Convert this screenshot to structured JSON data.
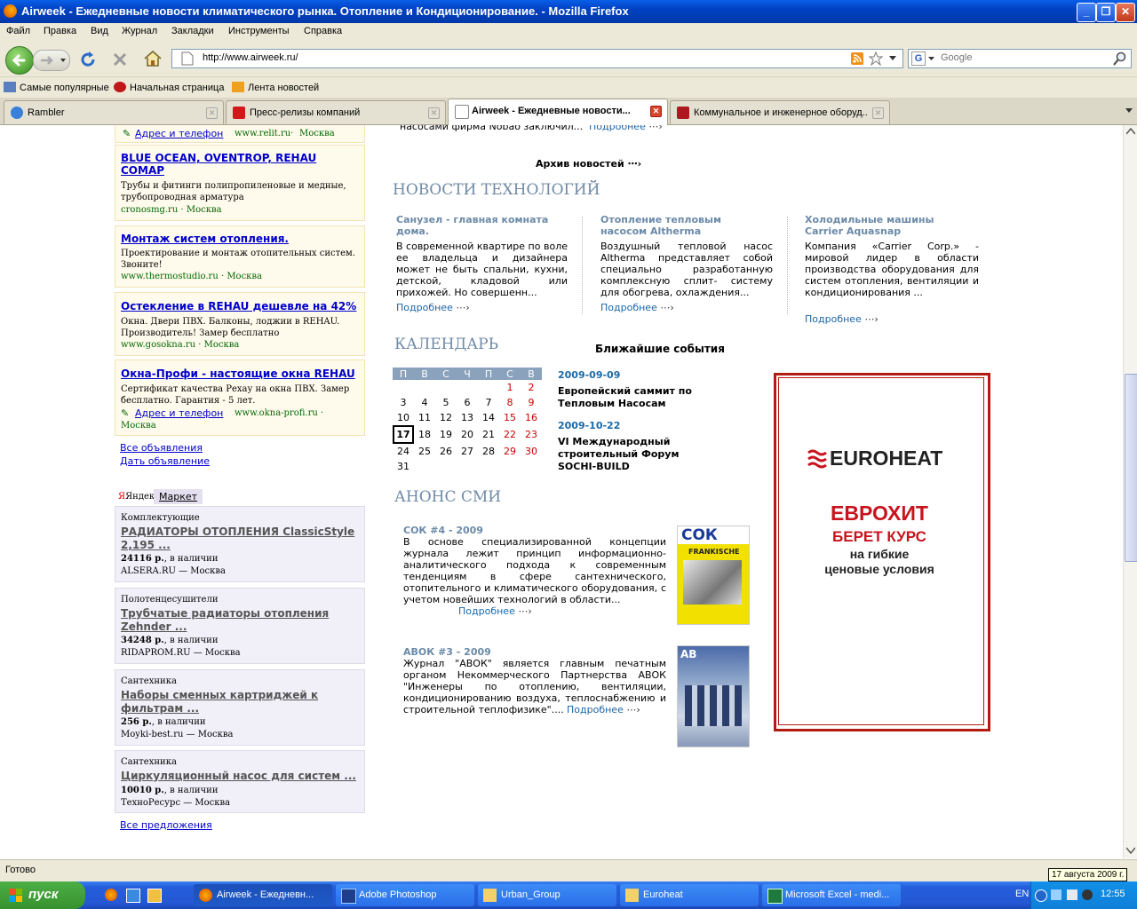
{
  "window": {
    "title": "Airweek - Ежедневные новости климатического рынка. Отопление и Кондиционирование. - Mozilla Firefox",
    "min": "_",
    "max": "❐",
    "close": "✕"
  },
  "menu": [
    "Файл",
    "Правка",
    "Вид",
    "Журнал",
    "Закладки",
    "Инструменты",
    "Справка"
  ],
  "nav": {
    "url": "http://www.airweek.ru/",
    "search_placeholder": "Google",
    "search_engine": "G"
  },
  "bookmarks": [
    "Самые популярные",
    "Начальная страница",
    "Лента новостей"
  ],
  "tabs": [
    {
      "label": "Rambler",
      "active": false
    },
    {
      "label": "Пресс-релизы компаний",
      "active": false
    },
    {
      "label": "Airweek - Ежедневные новости...",
      "active": true
    },
    {
      "label": "Коммунальное и инженерное оборуд...",
      "active": false
    }
  ],
  "ads": {
    "top_addr": "Адрес и телефон",
    "top_site": "www.relit.ru",
    "top_city": "Москва",
    "items": [
      {
        "title": "BLUE OCEAN, OVENTROP, REHAU COMAP",
        "desc": "Трубы и фитинги полипропиленовые и медные, трубопроводная арматура",
        "site": "cronosmg.ru",
        "city": "Москва"
      },
      {
        "title": "Монтаж систем отопления.",
        "desc": "Проектирование и монтаж отопительных систем. Звоните!",
        "site": "www.thermostudio.ru",
        "city": "Москва"
      },
      {
        "title": "Остекление в REHAU дешевле на 42%",
        "desc": "Окна. Двери ПВХ. Балконы, лоджии в REHAU. Производитель! Замер бесплатно",
        "site": "www.gosokna.ru",
        "city": "Москва"
      },
      {
        "title": "Окна-Профи - настоящие окна REHAU",
        "desc": "Сертификат качества Рехау на окна ПВХ. Замер бесплатно. Гарантия - 5 лет.",
        "addr": "Адрес и телефон",
        "site": "www.okna-profi.ru",
        "city": "Москва"
      }
    ],
    "all_ads": "Все объявления",
    "post_ad": "Дать объявление"
  },
  "market": {
    "tab_yandex": "Яндекс",
    "tab_market": "Маркет",
    "items": [
      {
        "cat": "Комплектующие",
        "title": "РАДИАТОРЫ ОТОПЛЕНИЯ ClassicStyle 2,195 ...",
        "price": "24116 р.",
        "stock": ", в наличии",
        "seller": "ALSERA.RU — Москва"
      },
      {
        "cat": "Полотенцесушители",
        "title": "Трубчатые радиаторы отопления Zehnder ...",
        "price": "34248 р.",
        "stock": ", в наличии",
        "seller": "RIDAPROM.RU — Москва"
      },
      {
        "cat": "Сантехника",
        "title": "Наборы сменных картриджей к фильтрам ...",
        "price": "256 р.",
        "stock": ", в наличии",
        "seller": "Moyki-best.ru — Москва"
      },
      {
        "cat": "Сантехника",
        "title": "Циркуляционный насос для систем ...",
        "price": "10010 р.",
        "stock": ", в наличии",
        "seller": "ТехноРесурс — Москва"
      }
    ],
    "all_offers": "Все предложения"
  },
  "news": {
    "top_snippet": "насосами фирма Nobao заключил...",
    "more": "Подробнее",
    "archive": "Архив новостей"
  },
  "tech": {
    "heading": "НОВОСТИ ТЕХНОЛОГИЙ",
    "items": [
      {
        "title": "Санузел - главная комната дома.",
        "text": "В современной квартире по воле ее владельца и дизайнера может не быть спальни, кухни, детской, кладовой или прихожей. Но совершенн..."
      },
      {
        "title": "Отопление тепловым насосом Altherma",
        "text": "Воздушный тепловой насос Altherma представляет собой специально разработанную комплексную сплит- систему для обогрева, охлаждения..."
      },
      {
        "title": "Холодильные машины Carrier Aquasnap",
        "text": "Компания «Carrier Corp.» - мировой лидер в области производства оборудования для систем отопления, вентиляции и кондиционирования ..."
      }
    ]
  },
  "calendar": {
    "heading": "КАЛЕНДАРЬ",
    "events_heading": "Ближайшие события",
    "days": [
      "П",
      "В",
      "С",
      "Ч",
      "П",
      "С",
      "В"
    ],
    "weeks": [
      [
        "",
        "",
        "",
        "",
        "",
        "1",
        "2"
      ],
      [
        "3",
        "4",
        "5",
        "6",
        "7",
        "8",
        "9"
      ],
      [
        "10",
        "11",
        "12",
        "13",
        "14",
        "15",
        "16"
      ],
      [
        "17",
        "18",
        "19",
        "20",
        "21",
        "22",
        "23"
      ],
      [
        "24",
        "25",
        "26",
        "27",
        "28",
        "29",
        "30"
      ],
      [
        "31",
        "",
        "",
        "",
        "",
        "",
        ""
      ]
    ],
    "today": "17",
    "events": [
      {
        "date": "2009-09-09",
        "title": "Европейский саммит по Тепловым Насосам"
      },
      {
        "date": "2009-10-22",
        "title": "VI Международный строительный Форум SOCHI-BUILD"
      }
    ]
  },
  "media": {
    "heading": "АНОНС СМИ",
    "items": [
      {
        "title": "СОК #4 - 2009",
        "text": "В основе специализированной концепции журнала лежит принцип информационно-аналитического подхода к современным тенденциям в сфере сантехнического, отопительного и климатического оборудования, с учетом новейших технологий в области...",
        "cover": "СОК",
        "cover_sub": "FRANKISCHE"
      },
      {
        "title": "АВОК #3 - 2009",
        "text": "Журнал \"АВОК\" является главным печатным органом Некоммерческого Партнерства АВОК \"Инженеры по отоплению, вентиляции, кондиционированию воздуха, теплоснабжению и строительной теплофизике\"....",
        "cover": "АВ"
      }
    ]
  },
  "banner": {
    "logo": "EUROHEAT",
    "line1": "ЕВРОХИТ",
    "line2": "БЕРЕТ КУРС",
    "line3": "на гибкие",
    "line4": "ценовые условия",
    "colors": {
      "red": "#c8141e",
      "dark": "#222222"
    }
  },
  "status": {
    "text": "Готово",
    "tooltip": "17 августа 2009 г."
  },
  "taskbar": {
    "start": "пуск",
    "tasks": [
      "Airweek - Ежедневн...",
      "Adobe Photoshop",
      "Urban_Group",
      "Euroheat",
      "Microsoft Excel - medi..."
    ],
    "lang": "EN",
    "clock": "12:55"
  }
}
